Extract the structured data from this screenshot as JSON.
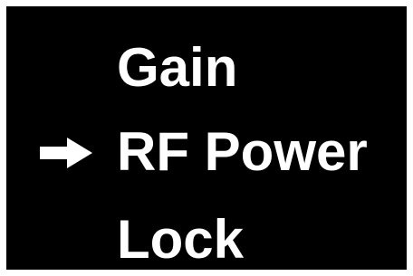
{
  "menu": {
    "items": [
      {
        "label": "Gain",
        "selected": false
      },
      {
        "label": "RF Power",
        "selected": true
      },
      {
        "label": "Lock",
        "selected": false
      }
    ],
    "selection_icon": "right-arrow-icon"
  },
  "colors": {
    "background": "#000000",
    "text": "#ffffff",
    "frame": "#ffffff"
  }
}
